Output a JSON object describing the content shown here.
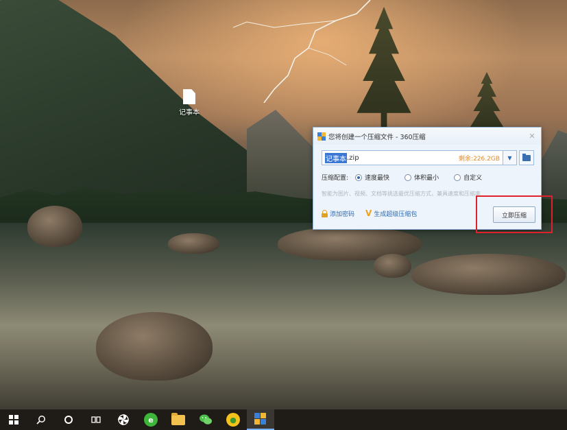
{
  "desktop": {
    "icon_label": "记事本"
  },
  "dialog": {
    "title": "您将创建一个压缩文件 - 360压缩",
    "close_glyph": "✕",
    "filename_selected": "记事本",
    "filename_ext": ".zip",
    "free_space": "剩余:226.2GB",
    "dropdown_glyph": "▼",
    "config_label": "压缩配置:",
    "options": [
      {
        "label": "速度最快",
        "checked": true
      },
      {
        "label": "体积最小",
        "checked": false
      },
      {
        "label": "自定义",
        "checked": false
      }
    ],
    "hint": "智能为图片、视频、文档等挑选最优压缩方式，兼具速度和压缩率",
    "add_password": "添加密码",
    "super_package": "生成超级压缩包",
    "compress_button": "立即压缩"
  },
  "taskbar": {
    "items": [
      {
        "name": "start",
        "icon": "windows-logo"
      },
      {
        "name": "search",
        "icon": "search-icon"
      },
      {
        "name": "cortana",
        "icon": "circle-icon"
      },
      {
        "name": "task-view",
        "icon": "task-view-icon"
      },
      {
        "name": "pinwheel-app",
        "icon": "pinwheel-icon"
      },
      {
        "name": "360-browser",
        "icon": "browser-e-icon"
      },
      {
        "name": "file-explorer",
        "icon": "folder-icon"
      },
      {
        "name": "wechat",
        "icon": "wechat-icon"
      },
      {
        "name": "360-security",
        "icon": "shield-360-icon"
      },
      {
        "name": "360-zip",
        "icon": "zip-app-icon"
      }
    ]
  },
  "colors": {
    "accent": "#2e6ab2",
    "highlight": "#e0202a",
    "free_space": "#e08a2a"
  }
}
